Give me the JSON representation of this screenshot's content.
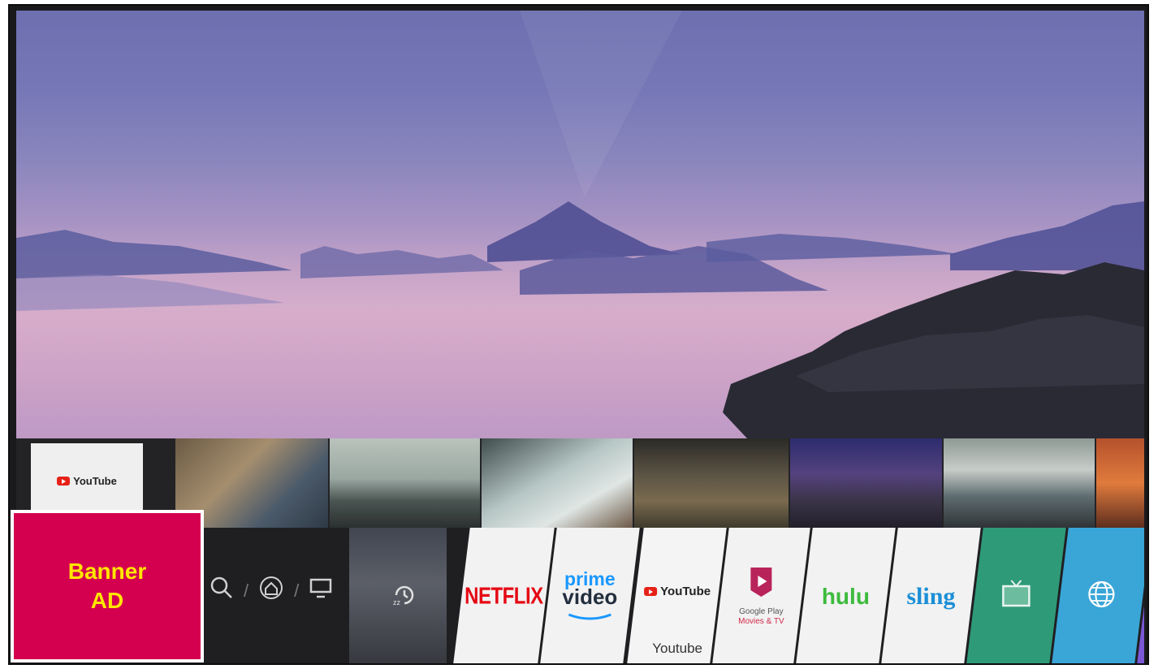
{
  "thumb_row": {
    "first_card_label": "YouTube"
  },
  "banner_ad": {
    "text": "Banner\nAD"
  },
  "nav": {
    "search_icon": "search-icon",
    "home_icon": "home-icon",
    "tv_icon": "monitor-icon",
    "recent_icon": "recent-history-icon"
  },
  "apps": {
    "netflix": "NETFLIX",
    "prime_top": "prime",
    "prime_bottom": "video",
    "youtube": "YouTube",
    "youtube_label": "Youtube",
    "google_play_line1": "Google Play",
    "google_play_line2": "Movies & TV",
    "hulu": "hulu",
    "sling": "sling"
  },
  "colors": {
    "banner_bg": "#d4004f",
    "banner_text": "#ffe600",
    "live_tv_tile": "#2f9a78",
    "browser_tile": "#3aa6d8",
    "music_tile": "#7b57d6"
  }
}
